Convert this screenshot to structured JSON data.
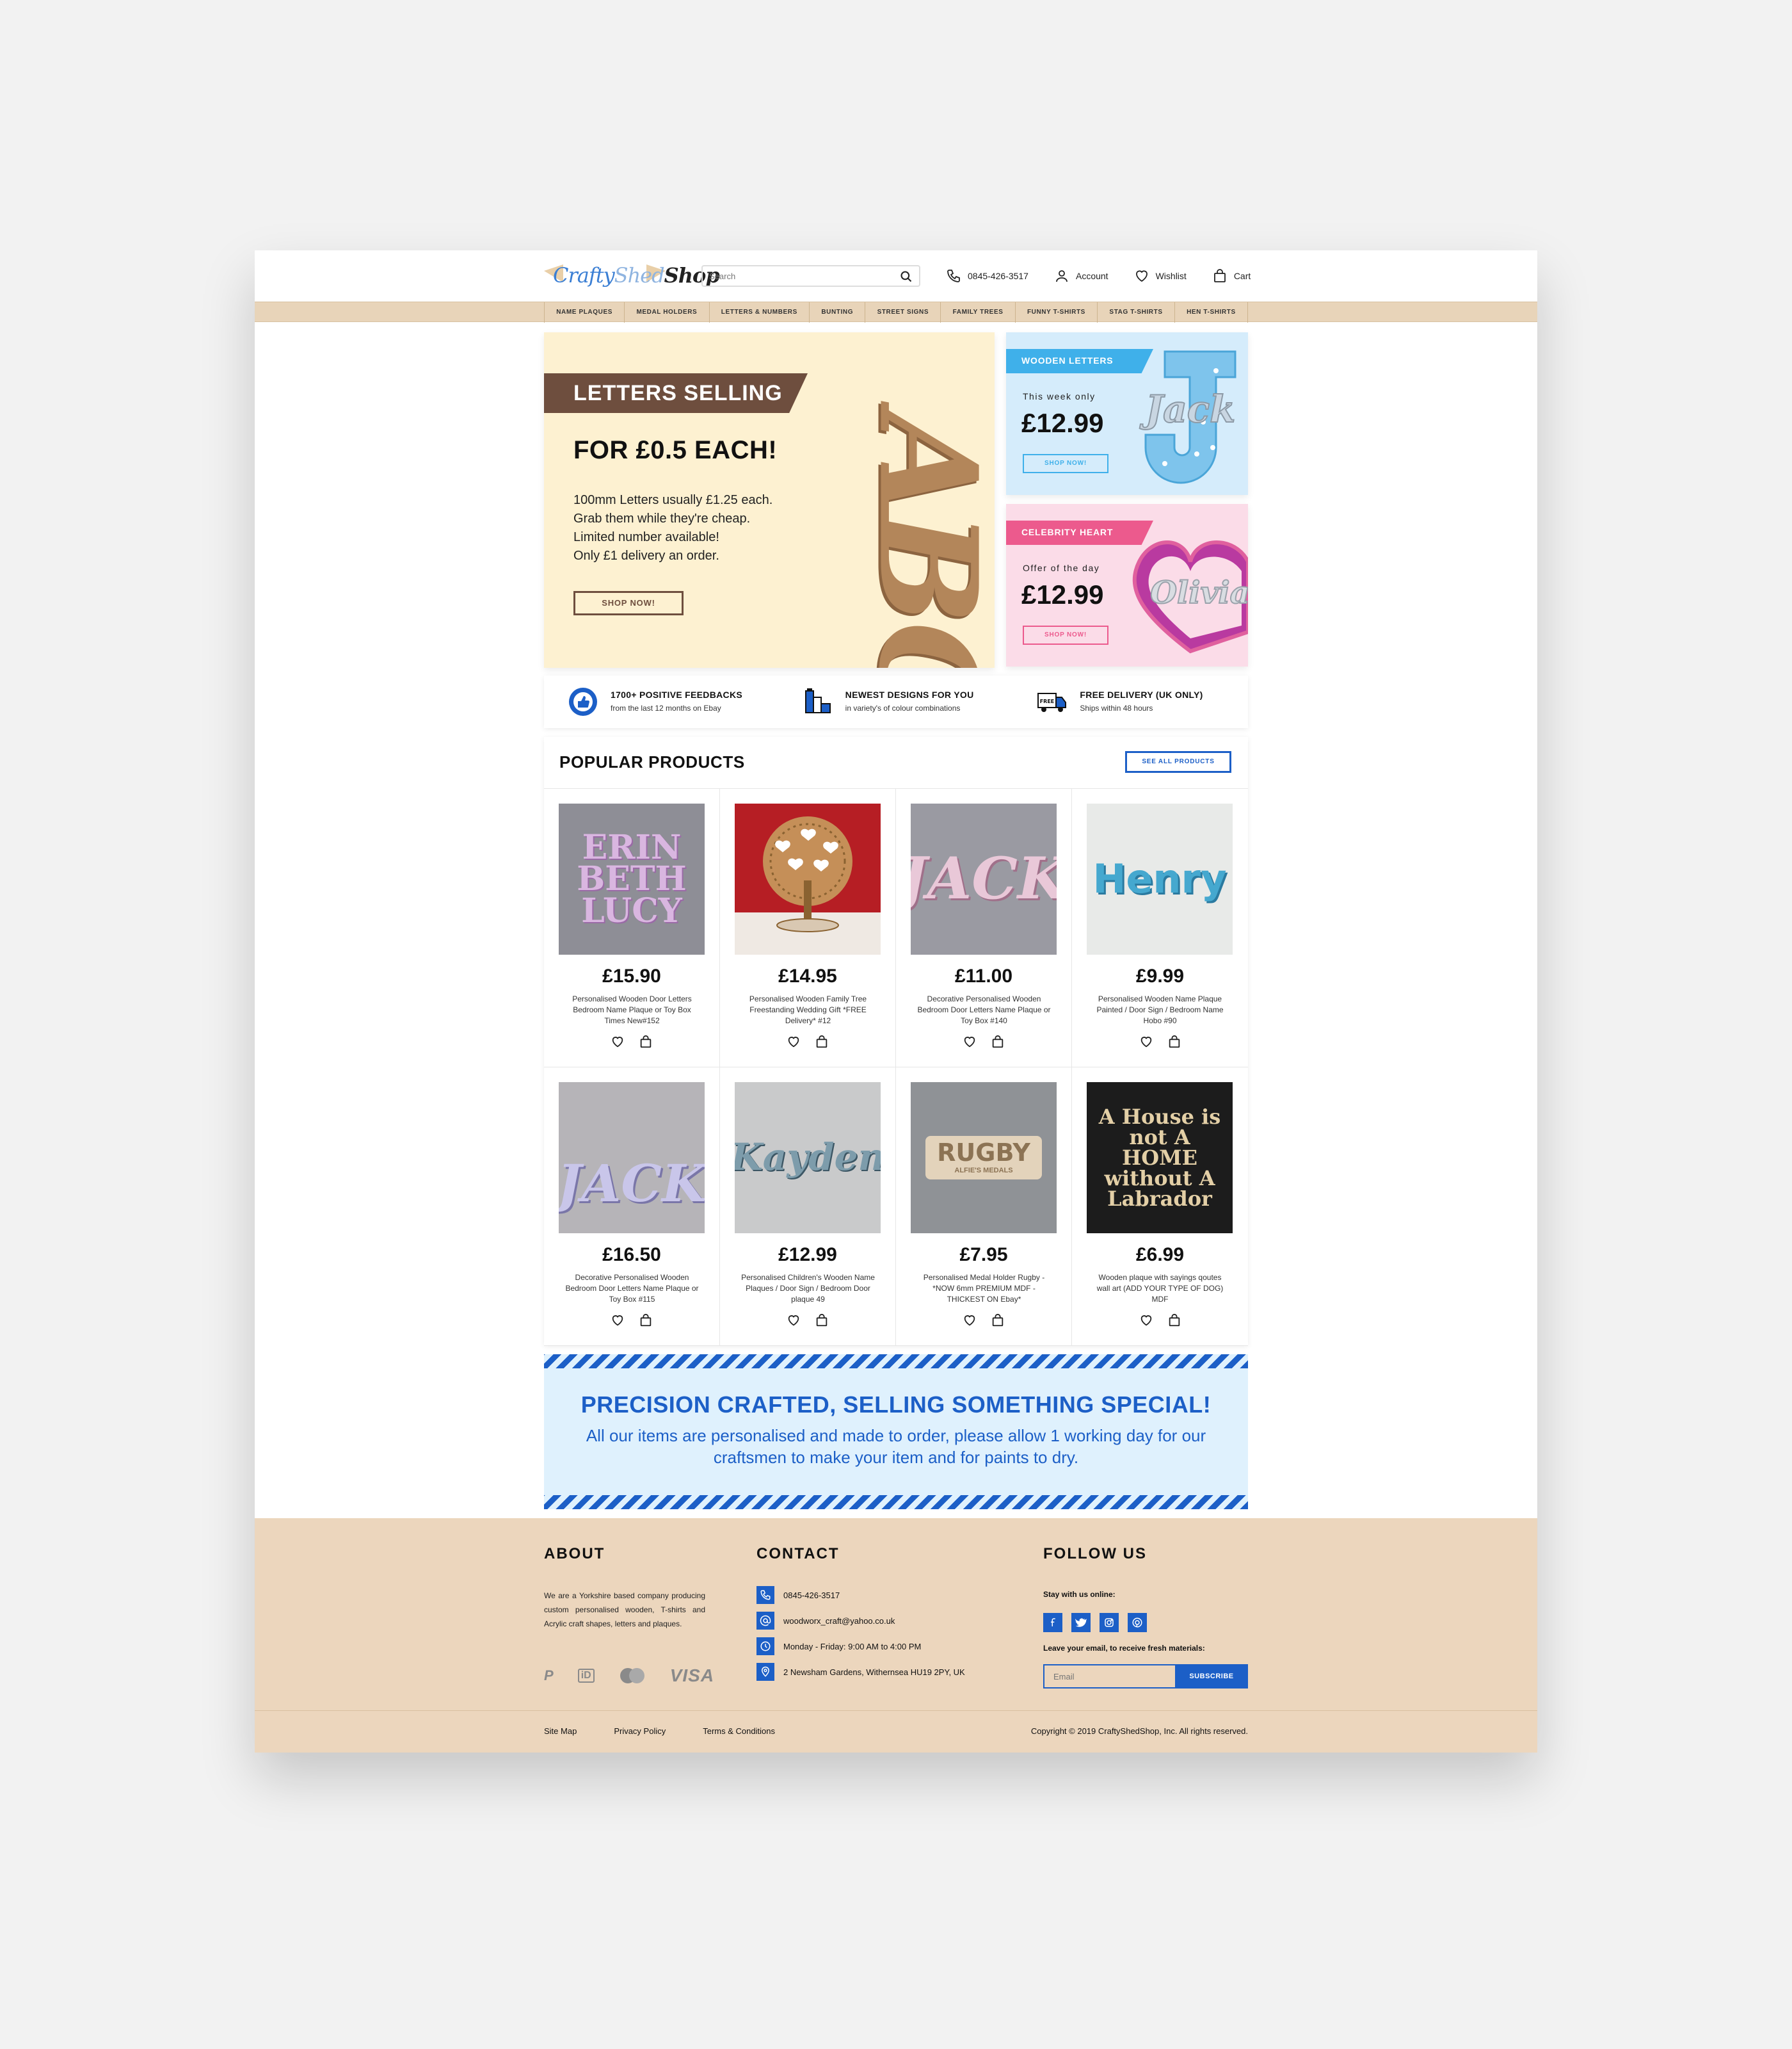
{
  "header": {
    "logo": {
      "w1": "Crafty",
      "w2": "Shed",
      "w3": "Shop"
    },
    "search_placeholder": "Search",
    "phone": "0845-426-3517",
    "account": "Account",
    "wishlist": "Wishlist",
    "cart": "Cart"
  },
  "nav": [
    "NAME PLAQUES",
    "MEDAL HOLDERS",
    "LETTERS & NUMBERS",
    "BUNTING",
    "STREET SIGNS",
    "FAMILY TREES",
    "FUNNY T-SHIRTS",
    "STAG T-SHIRTS",
    "HEN T-SHIRTS"
  ],
  "hero": {
    "ribbon": "LETTERS SELLING",
    "price": "FOR £0.5 EACH!",
    "desc": [
      "100mm Letters usually £1.25 each.",
      "Grab them while they're cheap.",
      "Limited number available!",
      "Only £1 delivery an order."
    ],
    "button": "SHOP NOW!",
    "art_text": "ABC"
  },
  "promos": [
    {
      "tag": "WOODEN LETTERS",
      "small": "This week only",
      "price": "£12.99",
      "button": "SHOP NOW!",
      "art_text": "Jack"
    },
    {
      "tag": "CELEBRITY HEART",
      "small": "Offer of the day",
      "price": "£12.99",
      "button": "SHOP NOW!",
      "art_text": "Olivia"
    }
  ],
  "features": [
    {
      "title": "1700+ POSITIVE FEEDBACKS",
      "sub": "from the last 12 months on Ebay",
      "icon": "thumbs-up-badge-icon"
    },
    {
      "title": "NEWEST DESIGNS FOR YOU",
      "sub": "in variety's of colour combinations",
      "icon": "paint-tubes-icon"
    },
    {
      "title": "FREE DELIVERY (UK ONLY)",
      "sub": "Ships within 48 hours",
      "icon": "delivery-truck-icon"
    }
  ],
  "products": {
    "title": "POPULAR PRODUCTS",
    "see_all": "SEE ALL PRODUCTS",
    "items": [
      {
        "price": "£15.90",
        "name": "Personalised Wooden Door Letters Bedroom Name Plaque or Toy Box Times New#152",
        "art": "ERIN BETH LUCY"
      },
      {
        "price": "£14.95",
        "name": "Personalised Wooden Family Tree Freestanding Wedding Gift *FREE Delivery* #12",
        "art": ""
      },
      {
        "price": "£11.00",
        "name": "Decorative Personalised Wooden Bedroom Door Letters Name Plaque or Toy Box #140",
        "art": "JACK"
      },
      {
        "price": "£9.99",
        "name": "Personalised Wooden Name Plaque Painted / Door Sign / Bedroom Name Hobo #90",
        "art": "Henry"
      },
      {
        "price": "£16.50",
        "name": "Decorative Personalised Wooden Bedroom Door Letters Name Plaque or Toy Box #115",
        "art": "JACK"
      },
      {
        "price": "£12.99",
        "name": "Personalised Children's Wooden Name Plaques / Door Sign / Bedroom Door plaque 49",
        "art": "Kayden"
      },
      {
        "price": "£7.95",
        "name": "Personalised Medal Holder Rugby - *NOW 6mm PREMIUM MDF - THICKEST ON Ebay*",
        "art": "RUGBY",
        "art_sub": "ALFIE'S MEDALS"
      },
      {
        "price": "£6.99",
        "name": "Wooden plaque with sayings qoutes wall art (ADD YOUR TYPE OF DOG) MDF",
        "art": "A House is not A HOME without A Labrador"
      }
    ]
  },
  "banner": {
    "title": "PRECISION CRAFTED, SELLING SOMETHING SPECIAL!",
    "desc": "All our items are personalised and made to order, please allow 1 working day for our craftsmen to make your item and for paints to dry."
  },
  "footer": {
    "about_title": "ABOUT",
    "about_text": "We are a Yorkshire based company producing custom personalised wooden, T-shirts and Acrylic craft shapes, letters and plaques.",
    "payments": [
      "P",
      "iD",
      "VISA"
    ],
    "contact_title": "CONTACT",
    "contact": [
      {
        "icon": "phone-icon",
        "text": "0845-426-3517"
      },
      {
        "icon": "email-icon",
        "text": "woodworx_craft@yahoo.co.uk"
      },
      {
        "icon": "clock-icon",
        "text": "Monday - Friday: 9:00 AM to 4:00 PM"
      },
      {
        "icon": "location-pin-icon",
        "text": "2 Newsham Gardens, Withernsea HU19 2PY, UK"
      }
    ],
    "follow_title": "FOLLOW US",
    "stay": "Stay with us online:",
    "leave": "Leave your email, to receive fresh materials:",
    "email_placeholder": "Email",
    "subscribe": "SUBSCRIBE",
    "links": [
      "Site Map",
      "Privacy Policy",
      "Terms & Conditions"
    ],
    "copyright": "Copyright © 2019 CraftyShedShop, Inc. All rights reserved."
  },
  "colors": {
    "accent_blue": "#1c5fc7",
    "nav_tan": "#e8d4b9",
    "footer_tan": "#ecd6bd",
    "hero_cream": "#fdf1d1",
    "ribbon_brown": "#6e4e3e",
    "promo_blue": "#3fb0ea",
    "promo_pink": "#ec5a8d"
  }
}
